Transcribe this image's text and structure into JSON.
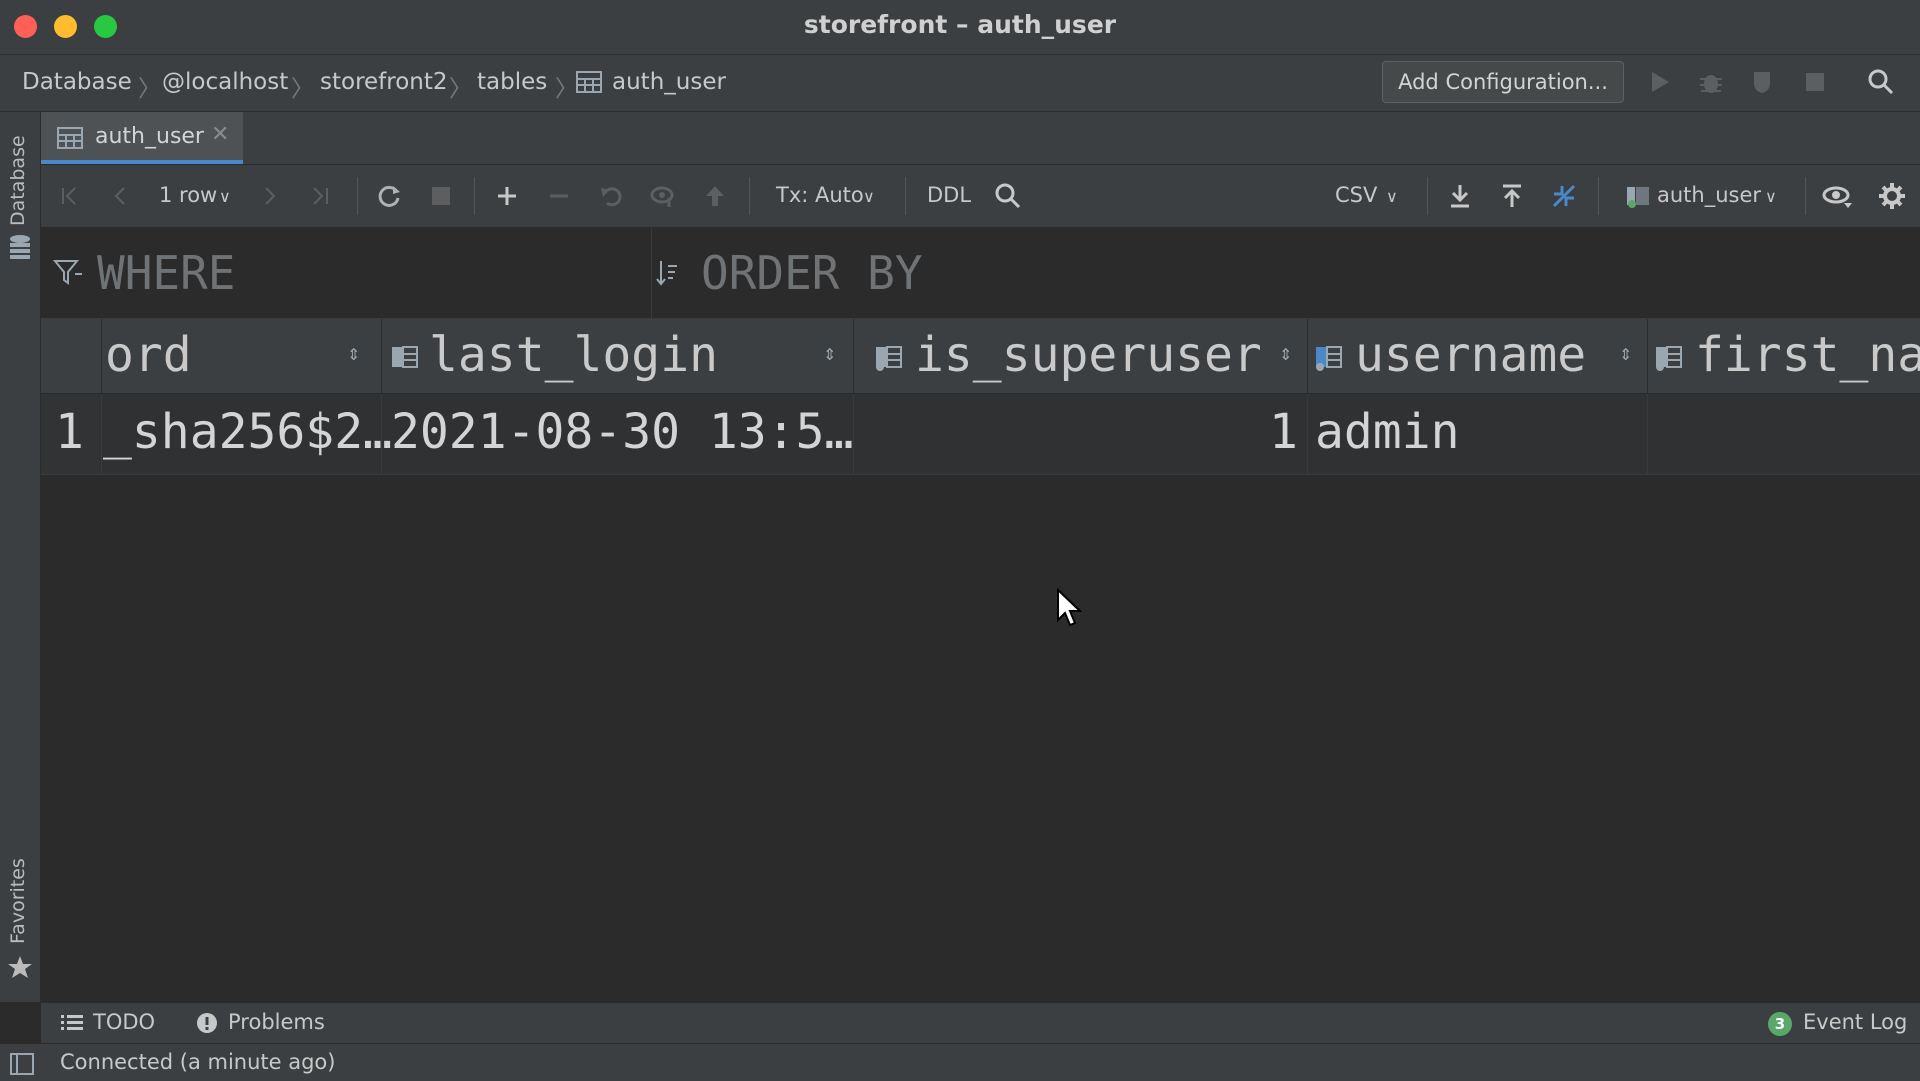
{
  "window": {
    "title": "storefront – auth_user"
  },
  "breadcrumbs": [
    "Database",
    "@localhost",
    "storefront2",
    "tables",
    "auth_user"
  ],
  "navbar": {
    "add_configuration": "Add Configuration..."
  },
  "left_panel": {
    "top_label": "Database",
    "bottom_label": "Favorites"
  },
  "tab": {
    "label": "auth_user"
  },
  "toolbar": {
    "rows": "1 row",
    "tx_mode": "Tx: Auto",
    "ddl": "DDL",
    "export_format": "CSV",
    "table_selector": "auth_user"
  },
  "filters": {
    "where": "WHERE",
    "order_by": "ORDER BY"
  },
  "grid": {
    "columns": [
      "ord",
      "last_login",
      "is_superuser",
      "username",
      "first_na"
    ],
    "rows": [
      {
        "num": "1",
        "cells": [
          "_sha256$2…",
          "2021-08-30 13:5…",
          "1",
          "admin",
          ""
        ]
      }
    ]
  },
  "bottom_tools": {
    "todo": "TODO",
    "problems": "Problems",
    "event_log": "Event Log",
    "event_count": "3"
  },
  "status": {
    "text": "Connected (a minute ago)"
  },
  "colors": {
    "accent": "#4a88c7",
    "success": "#59a869",
    "close": "#ff5f57",
    "minimize": "#febc2e",
    "maximize": "#28c840"
  }
}
